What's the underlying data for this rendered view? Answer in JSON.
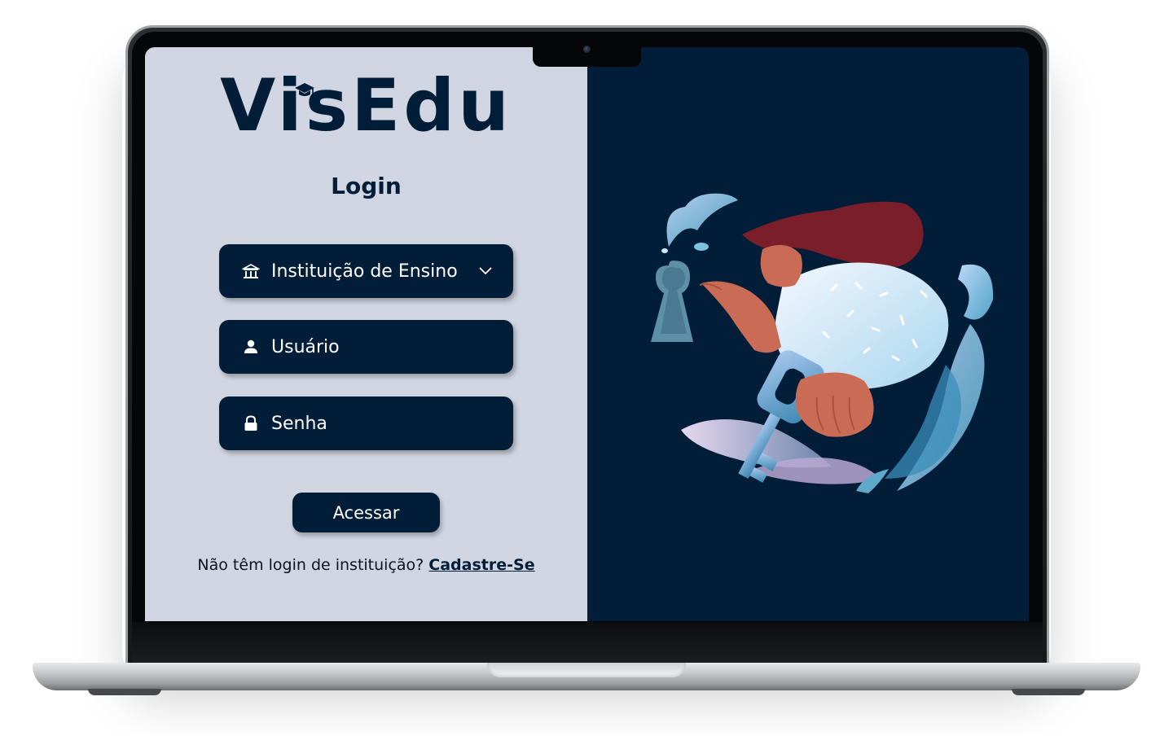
{
  "brand": {
    "name": "VisEdu",
    "primary_color": "#021d38",
    "panel_color": "#d0d5e1"
  },
  "login": {
    "title": "Login",
    "institution_select": {
      "label": "Instituição de Ensino",
      "icon": "institution-icon"
    },
    "user_field": {
      "label": "Usuário",
      "icon": "user-icon"
    },
    "password_field": {
      "label": "Senha",
      "icon": "lock-icon"
    },
    "submit_label": "Acessar",
    "signup_prompt": "Não têm login de instituição?",
    "signup_link": "Cadastre-Se"
  },
  "illustration": {
    "subject": "keyhole-key-woman-illustration"
  }
}
